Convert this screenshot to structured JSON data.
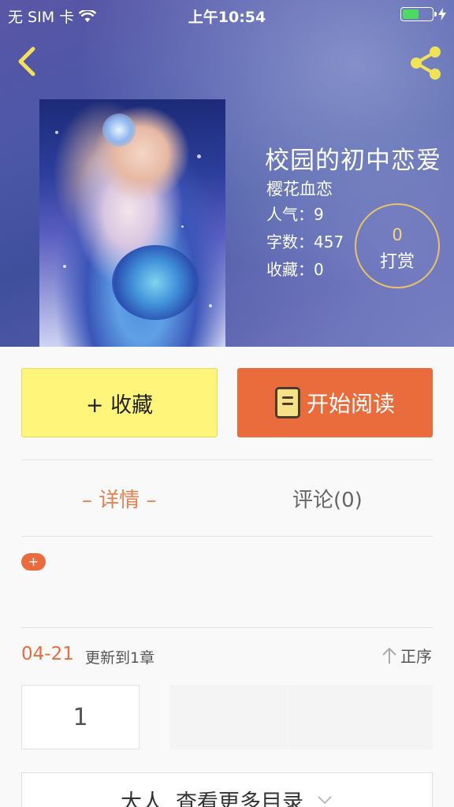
{
  "status": {
    "carrier": "无 SIM 卡",
    "time": "上午10:54",
    "battery_level": 0.55
  },
  "book": {
    "title": "校园的初中恋爱",
    "author": "樱花血恋",
    "popularity": "人气：9",
    "word_count": "字数：457",
    "favorites": "收藏：0"
  },
  "tip": {
    "count": "0",
    "label": "打赏"
  },
  "actions": {
    "favorite_label": "+ 收藏",
    "read_label": "开始阅读"
  },
  "tabs": [
    {
      "label": "– 详情 –",
      "active": true
    },
    {
      "label": "评论(0)",
      "active": false
    }
  ],
  "detail": {
    "tag_button": "+"
  },
  "updates": {
    "date": "04-21",
    "text": "更新到1章",
    "sort_label": "正序"
  },
  "chapters": [
    {
      "number": "1"
    }
  ],
  "more": {
    "label_a": "大人",
    "label_b": "查看更多目录"
  },
  "colors": {
    "accent": "#ea6c3c",
    "favorite_button": "#fef57a",
    "tip_ring": "#e8c36a"
  },
  "icons": [
    "back-arrow-icon",
    "share-icon",
    "wifi-icon",
    "battery-icon",
    "charging-icon",
    "book-icon",
    "sort-arrow-icon",
    "chevron-down-icon"
  ]
}
